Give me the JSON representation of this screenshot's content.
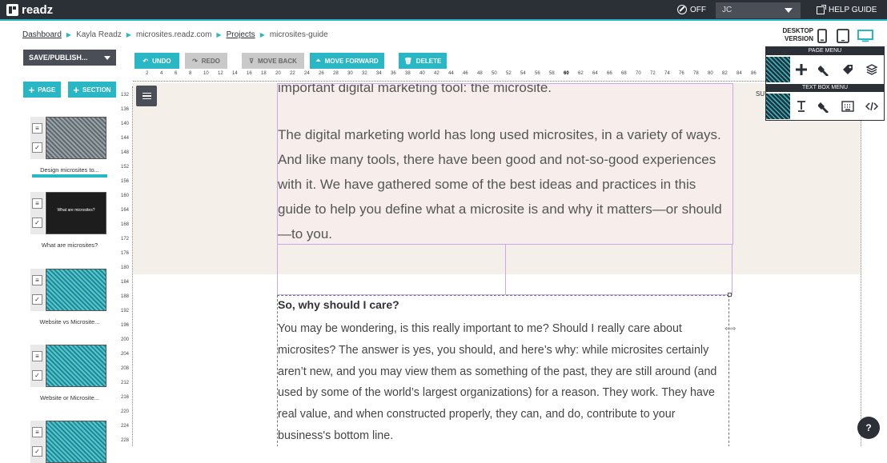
{
  "app": {
    "logo_text": "readz"
  },
  "topbar": {
    "off_label": "OFF",
    "user": "JC",
    "help_label": "HELP GUIDE"
  },
  "breadcrumb": [
    "Dashboard",
    "Kayla Readz",
    "microsites.readz.com",
    "Projects",
    "microsites-guide"
  ],
  "save_publish": "SAVE/PUBLISH...",
  "toolbar": {
    "undo": "UNDO",
    "redo": "REDO",
    "move_back": "MOVE BACK",
    "move_forward": "MOVE FORWARD",
    "delete": "DELETE"
  },
  "add_page": "PAGE",
  "add_section": "SECTION",
  "ruler_h": [
    "2",
    "4",
    "6",
    "8",
    "10",
    "12",
    "14",
    "16",
    "18",
    "20",
    "22",
    "24",
    "26",
    "28",
    "30",
    "32",
    "34",
    "36",
    "38",
    "40",
    "42",
    "44",
    "46",
    "48",
    "50",
    "52",
    "54",
    "56",
    "58",
    "60",
    "62",
    "64",
    "66",
    "68",
    "70",
    "72",
    "74",
    "76",
    "78",
    "80",
    "82",
    "84",
    "86"
  ],
  "ruler_v": [
    "132",
    "136",
    "140",
    "144",
    "148",
    "152",
    "156",
    "160",
    "164",
    "168",
    "172",
    "176",
    "180",
    "184",
    "188",
    "192",
    "196",
    "200",
    "204",
    "208",
    "212",
    "216",
    "220",
    "224",
    "228"
  ],
  "pages": [
    {
      "caption": "Design microsites to...",
      "style": "hatch-gray"
    },
    {
      "caption": "What are microsites?",
      "style": "dark",
      "thumb_text": "What are microsites?"
    },
    {
      "caption": "Website vs Microsite...",
      "style": "hatch-teal"
    },
    {
      "caption": "Website or Microsite...",
      "style": "hatch-teal"
    },
    {
      "caption": "",
      "style": "hatch-teal"
    }
  ],
  "device": {
    "label_line1": "DESKTOP",
    "label_line2": "VERSION"
  },
  "page_menu": {
    "title": "PAGE MENU"
  },
  "text_box_menu": {
    "title": "TEXT BOX MENU"
  },
  "canvas_side_label": "SU",
  "content": {
    "top_fragment": "important digital marketing tool: the microsite.",
    "intro": "The digital marketing world has long used microsites, in a variety of ways. And like many tools, there have been good and not-so-good experiences with it. We have gathered some of the best ideas and practices in this guide to help you define what a microsite is and why it matters—or should—to you.",
    "heading": "So, why should I care?",
    "body": "You may be wondering, is this really important to me? Should I really care about microsites? The answer is yes, you should, and here’s why: while microsites certainly aren’t new, and you may view them as something of the past, they are still around (and used by some of the world’s largest organizations) for a reason. They work. They have real value, and when constructed properly, they can, and do, contribute to your business's bottom line."
  },
  "chat_icon": "?",
  "colors": {
    "accent": "#29b6c5",
    "dark": "#2b2f36",
    "band": "#f5efea",
    "box_border": "#c9a9e9"
  }
}
